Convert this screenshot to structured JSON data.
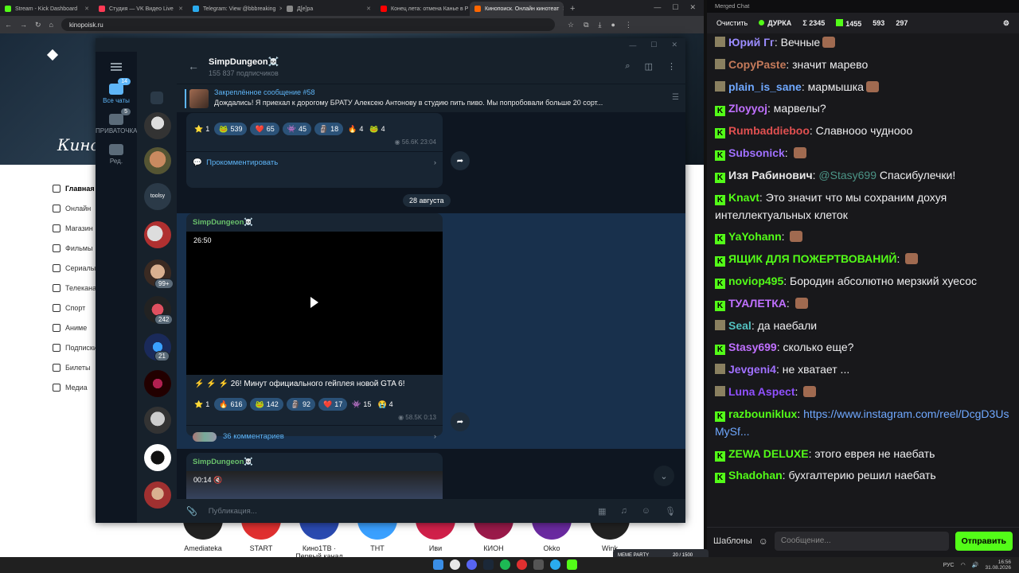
{
  "browser": {
    "tabs": [
      {
        "label": "Stream - Kick Dashboard",
        "color": "#53fc18"
      },
      {
        "label": "Студия — VK Видео Live",
        "color": "#ff3a55"
      },
      {
        "label": "Telegram: View @bbbreaking",
        "color": "#2aabee"
      },
      {
        "label": "Д[е]ра",
        "color": "#888888"
      },
      {
        "label": "Конец лета: отмена Канье в Р",
        "color": "#ff0000"
      },
      {
        "label": "Кинопоиск. Онлайн кинотеат",
        "color": "#ff6600"
      }
    ],
    "new_tab": "+",
    "url": "kinopoisk.ru"
  },
  "site": {
    "logo": "Кино",
    "nav": [
      "Главная",
      "Онлайн",
      "Магазин",
      "Фильмы",
      "Сериалы",
      "Телеканалы",
      "Спорт",
      "Аниме",
      "Подписки",
      "Билеты",
      "Медиа"
    ],
    "channels": [
      "Amediateka",
      "START",
      "Кино1ТВ · Первый канал",
      "ТНТ",
      "Иви",
      "КИОН",
      "Okko",
      "Wink"
    ]
  },
  "telegram": {
    "folders": [
      {
        "label": "Все чаты",
        "badge": "14"
      },
      {
        "label": "ПРИВАТОЧКА",
        "badge": "5"
      },
      {
        "label": "Ред.",
        "badge": ""
      }
    ],
    "chat_badges": [
      "99+",
      "242",
      "21"
    ],
    "channel": {
      "title": "SimpDungeon☠️",
      "subscribers": "155 837 подписчиков"
    },
    "pinned": {
      "title": "Закреплённое сообщение #58",
      "text": "Дождались!  Я приехал к дорогому БРАТУ Алексею Антонову в студию пить пиво. Мы попробовали больше 20 сорт..."
    },
    "msg1": {
      "reactions": [
        {
          "emoji": "⭐",
          "count": "1"
        },
        {
          "emoji": "🐸",
          "count": "539"
        },
        {
          "emoji": "❤️",
          "count": "65"
        },
        {
          "emoji": "👾",
          "count": "45"
        },
        {
          "emoji": "🗿",
          "count": "18"
        },
        {
          "emoji": "🔥",
          "count": "4"
        },
        {
          "emoji": "🐸",
          "count": "4"
        }
      ],
      "views": "56.6K",
      "time": "23:04",
      "comment_label": "Прокомментировать"
    },
    "date_divider": "28 августа",
    "msg2": {
      "sender": "SimpDungeon☠️",
      "duration": "26:50",
      "caption": "⚡ ⚡ ⚡ 26! Минут официального гейплея новой GTA 6!",
      "reactions": [
        {
          "emoji": "⭐",
          "count": "1"
        },
        {
          "emoji": "🔥",
          "count": "616"
        },
        {
          "emoji": "🐸",
          "count": "142"
        },
        {
          "emoji": "🗿",
          "count": "92"
        },
        {
          "emoji": "❤️",
          "count": "17"
        },
        {
          "emoji": "👾",
          "count": "15"
        },
        {
          "emoji": "😭",
          "count": "4"
        }
      ],
      "views": "58.5K",
      "time": "0:13",
      "comments": "36 комментариев"
    },
    "msg3": {
      "sender": "SimpDungeon☠️",
      "duration": "00:14"
    },
    "compose_placeholder": "Публикация..."
  },
  "chat": {
    "window_title": "Merged Chat",
    "clear_label": "Очистить",
    "stats": {
      "name": "ДУРКА",
      "sigma": "Σ 2345",
      "kick": "1455",
      "s3": "593",
      "s4": "297"
    },
    "messages": [
      {
        "user": "Юрий Гг",
        "color": "#9b8cff",
        "text": "Вечные"
      },
      {
        "user": "CopyPaste",
        "color": "#c47a5a",
        "text": "значит марево"
      },
      {
        "user": "plain_is_sane",
        "color": "#6fa8ff",
        "text": "мармышка"
      },
      {
        "user": "Zloyyoj",
        "color": "#c070ff",
        "text": "марвелы?"
      },
      {
        "user": "Rumbaddieboo",
        "color": "#e05050",
        "text": "Славнооо чудноoo"
      },
      {
        "user": "Subsonick",
        "color": "#a070ff",
        "text": ""
      },
      {
        "user": "Изя Рабинович",
        "color": "#e8e8e8",
        "text": "Спасибулечки!",
        "mention": "@Stasy699"
      },
      {
        "user": "Knavt",
        "color": "#53fc18",
        "text": "Это значит что мы сохраним дохуя интеллектуальных клеток"
      },
      {
        "user": "YaYohann",
        "color": "#53fc18",
        "text": ""
      },
      {
        "user": "ЯЩИК ДЛЯ ПОЖЕРТВОВАНИЙ",
        "color": "#53fc18",
        "text": ""
      },
      {
        "user": "noviop495",
        "color": "#53fc18",
        "text": "Бородин абсолютно мерзкий хуесос"
      },
      {
        "user": "ТУАЛЕТКА",
        "color": "#c070ff",
        "text": ""
      },
      {
        "user": "Seal",
        "color": "#53c0c0",
        "text": "да наебали"
      },
      {
        "user": "Stasy699",
        "color": "#c070ff",
        "text": "сколько еще?"
      },
      {
        "user": "Jevgeni4",
        "color": "#a070ff",
        "text": "не хватает ..."
      },
      {
        "user": "Luna Aspect",
        "color": "#9050ff",
        "text": ""
      },
      {
        "user": "razbouniklux",
        "color": "#53fc18",
        "text": "https://www.instagram.com/reel/DcgD3UsMySf..."
      },
      {
        "user": "ZEWA DELUXE",
        "color": "#53fc18",
        "text": "этого еврея не наебать"
      },
      {
        "user": "Shadohan",
        "color": "#53fc18",
        "text": "бухгалтерию решил наебать"
      }
    ],
    "templates_label": "Шаблоны",
    "input_placeholder": "Сообщение...",
    "send_label": "Отправить"
  },
  "taskbar": {
    "lang": "РУС",
    "time": "16:56",
    "date": "31.08.2026",
    "meme_label": "MEME PARTY",
    "meme_counter": "20 / 1500"
  }
}
